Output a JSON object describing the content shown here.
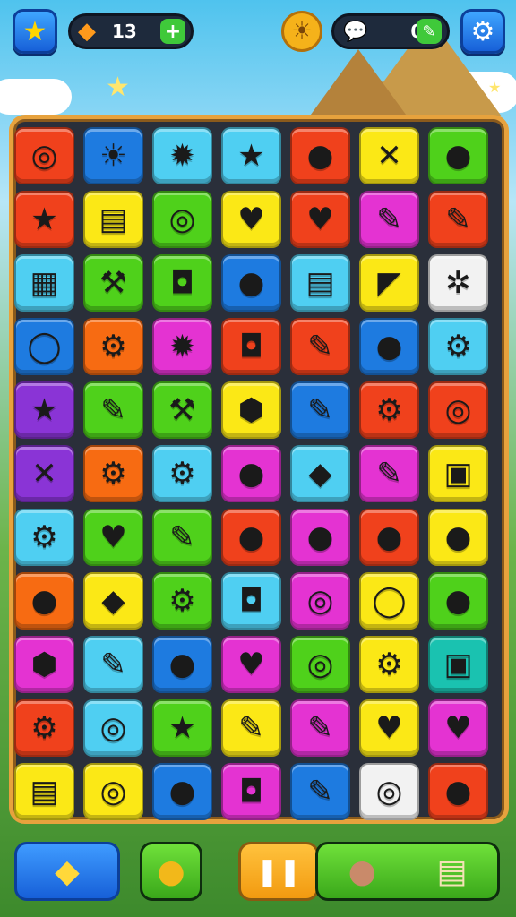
{
  "top_bar": {
    "star_button_icon": "star-icon",
    "coins_value": "13",
    "coins_icon": "gem-icon",
    "add_coins_label": "+",
    "sun_icon": "sun-icon",
    "lives_value": "0",
    "lives_icon": "speech-bubble-icon",
    "settings_icon": "gear-icon"
  },
  "board": {
    "rows": 11,
    "cols": 7,
    "tiles": [
      [
        "red",
        "◎"
      ],
      [
        "blue",
        "☀"
      ],
      [
        "cyan",
        "✹"
      ],
      [
        "cyan",
        "★"
      ],
      [
        "red",
        "●"
      ],
      [
        "yellow",
        "✕"
      ],
      [
        "green",
        "●"
      ],
      [
        "red",
        "★"
      ],
      [
        "yellow",
        "▤"
      ],
      [
        "green",
        "◎"
      ],
      [
        "yellow",
        "♥"
      ],
      [
        "red",
        "♥"
      ],
      [
        "magenta",
        "✎"
      ],
      [
        "red",
        "✎"
      ],
      [
        "cyan",
        "▦"
      ],
      [
        "green",
        "⚒"
      ],
      [
        "green",
        "◘"
      ],
      [
        "blue",
        "●"
      ],
      [
        "cyan",
        "▤"
      ],
      [
        "yellow",
        "◤"
      ],
      [
        "white",
        "✲"
      ],
      [
        "blue",
        "◯"
      ],
      [
        "orange",
        "⚙"
      ],
      [
        "magenta",
        "✹"
      ],
      [
        "red",
        "◘"
      ],
      [
        "red",
        "✎"
      ],
      [
        "blue",
        "●"
      ],
      [
        "cyan",
        "⚙"
      ],
      [
        "purple",
        "★"
      ],
      [
        "green",
        "✎"
      ],
      [
        "green",
        "⚒"
      ],
      [
        "yellow",
        "⬢"
      ],
      [
        "blue",
        "✎"
      ],
      [
        "red",
        "⚙"
      ],
      [
        "red",
        "◎"
      ],
      [
        "purple",
        "✕"
      ],
      [
        "orange",
        "⚙"
      ],
      [
        "cyan",
        "⚙"
      ],
      [
        "magenta",
        "●"
      ],
      [
        "cyan",
        "◆"
      ],
      [
        "magenta",
        "✎"
      ],
      [
        "yellow",
        "▣"
      ],
      [
        "cyan",
        "⚙"
      ],
      [
        "green",
        "♥"
      ],
      [
        "green",
        "✎"
      ],
      [
        "red",
        "●"
      ],
      [
        "magenta",
        "●"
      ],
      [
        "red",
        "●"
      ],
      [
        "yellow",
        "●"
      ],
      [
        "orange",
        "●"
      ],
      [
        "yellow",
        "◆"
      ],
      [
        "green",
        "⚙"
      ],
      [
        "cyan",
        "◘"
      ],
      [
        "magenta",
        "◎"
      ],
      [
        "yellow",
        "◯"
      ],
      [
        "green",
        "●"
      ],
      [
        "magenta",
        "⬢"
      ],
      [
        "cyan",
        "✎"
      ],
      [
        "blue",
        "●"
      ],
      [
        "magenta",
        "♥"
      ],
      [
        "green",
        "◎"
      ],
      [
        "yellow",
        "⚙"
      ],
      [
        "teal",
        "▣"
      ],
      [
        "red",
        "⚙"
      ],
      [
        "cyan",
        "◎"
      ],
      [
        "green",
        "★"
      ],
      [
        "yellow",
        "✎"
      ],
      [
        "magenta",
        "✎"
      ],
      [
        "yellow",
        "♥"
      ],
      [
        "magenta",
        "♥"
      ],
      [
        "yellow",
        "▤"
      ],
      [
        "yellow",
        "◎"
      ],
      [
        "blue",
        "●"
      ],
      [
        "magenta",
        "◘"
      ],
      [
        "blue",
        "✎"
      ],
      [
        "white",
        "◎"
      ],
      [
        "red",
        "●"
      ]
    ]
  },
  "bottom_bar": {
    "left_button_icon": "bag-icon",
    "middle_button_icon": "lemon-icon",
    "pause_icon": "pause-icon",
    "veggie_icon": "turnip-icon",
    "scroll_icon": "scroll-icon"
  },
  "colors": {
    "board_border": "#e7a23d",
    "board_bg": "#2a2f3a",
    "button_blue": "#1e7be0",
    "button_green": "#4fd11b"
  }
}
